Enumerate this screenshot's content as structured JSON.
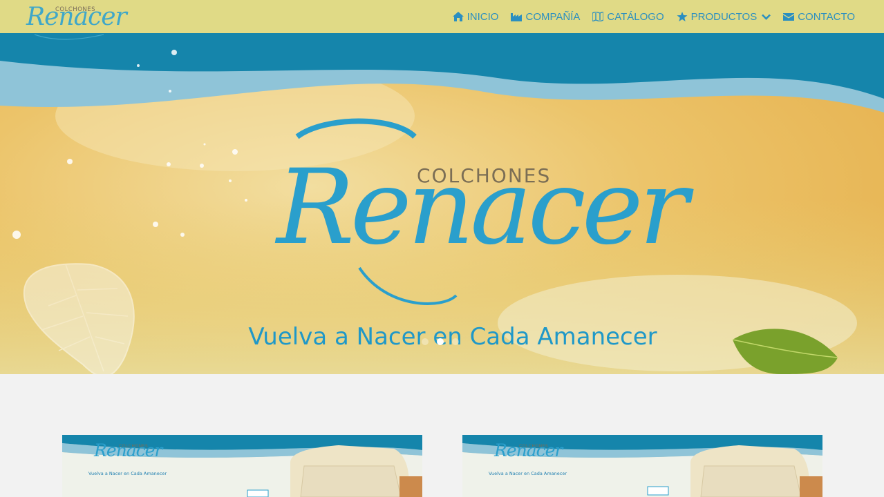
{
  "brand": {
    "logo_small": "COLCHONES",
    "logo_big": "Renacer"
  },
  "nav": {
    "items": [
      {
        "label": "INICIO",
        "icon": "home-icon"
      },
      {
        "label": "COMPAÑÍA",
        "icon": "industry-icon"
      },
      {
        "label": "CATÁLOGO",
        "icon": "map-icon"
      },
      {
        "label": "PRODUCTOS",
        "icon": "star-icon",
        "dropdown": true
      },
      {
        "label": "CONTACTO",
        "icon": "envelope-icon"
      }
    ]
  },
  "hero": {
    "small": "COLCHONES",
    "big": "Renacer",
    "tagline": "Vuelva a Nacer en Cada Amanecer",
    "slides": 3,
    "active_slide": 1
  },
  "cards": [
    {
      "small": "COLCHONES",
      "big": "Renacer",
      "tagline": "Vuelva a Nacer en Cada Amanecer"
    },
    {
      "small": "COLCHONES",
      "big": "Renacer",
      "tagline": "Vuelva a Nacer en Cada Amanecer"
    }
  ],
  "colors": {
    "header_bg": "#e0da86",
    "nav_text": "#2b8fc0",
    "hero_wave": "#1585ab",
    "hero_gold": "#e7b14f",
    "page_bg": "#f2f2f2"
  }
}
